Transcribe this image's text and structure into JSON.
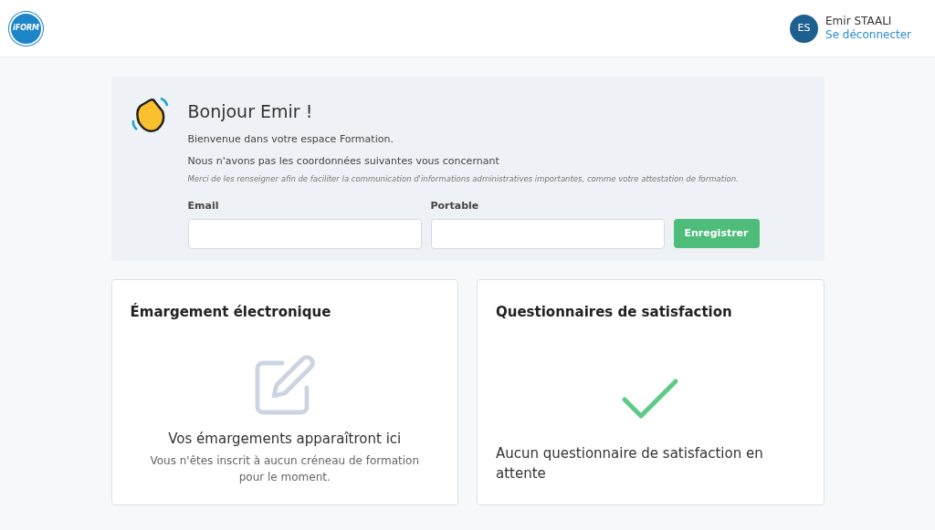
{
  "header": {
    "logo_text": "iFORM",
    "user": {
      "initials": "ES",
      "name": "Emir STAALI",
      "logout": "Se déconnecter"
    }
  },
  "welcome": {
    "title": "Bonjour Emir !",
    "intro": "Bienvenue dans votre espace Formation.",
    "notice": "Nous n'avons pas les coordonnées suivantes vous concernant",
    "hint": "Merci de les renseigner afin de faciliter la communication d'informations administratives importantes, comme votre attestation de formation.",
    "fields": [
      {
        "label": "Email"
      },
      {
        "label": "Portable"
      }
    ],
    "button": "Enregistrer"
  },
  "cards": [
    {
      "kind": "edit",
      "title": "Émargement électronique",
      "message": "Vos émargements apparaîtront ici",
      "detail": "Vous n'êtes inscrit à aucun créneau de formation pour le moment."
    },
    {
      "kind": "check",
      "title": "Questionnaires de satisfaction",
      "message": "Aucun questionnaire de satisfaction en attente"
    }
  ]
}
